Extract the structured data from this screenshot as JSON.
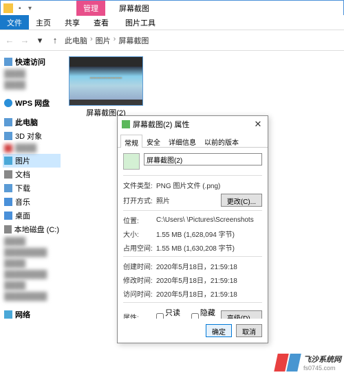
{
  "window": {
    "ribbon_context": "管理",
    "title": "屏幕截图",
    "tabs": [
      "文件",
      "主页",
      "共享",
      "查看"
    ],
    "context_tool": "图片工具"
  },
  "breadcrumb": {
    "items": [
      "此电脑",
      "图片",
      "屏幕截图"
    ]
  },
  "sidebar": {
    "quick": "快速访问",
    "wps": "WPS 网盘",
    "pc": "此电脑",
    "items": [
      {
        "icon": "cube",
        "label": "3D 对象"
      },
      {
        "icon": "vid",
        "label": "视频"
      },
      {
        "icon": "pic",
        "label": "图片"
      },
      {
        "icon": "doc",
        "label": "文档"
      },
      {
        "icon": "dl",
        "label": "下载"
      },
      {
        "icon": "mus",
        "label": "音乐"
      },
      {
        "icon": "desk",
        "label": "桌面"
      },
      {
        "icon": "disk",
        "label": "本地磁盘 (C:)"
      }
    ],
    "network": "网络"
  },
  "thumb": {
    "label": "屏幕截图(2)",
    "overlay": "····················"
  },
  "dialog": {
    "title": "屏幕截图(2) 属性",
    "tabs": [
      "常规",
      "安全",
      "详细信息",
      "以前的版本"
    ],
    "filename": "屏幕截图(2)",
    "rows": {
      "type_l": "文件类型:",
      "type_v": "PNG 图片文件 (.png)",
      "open_l": "打开方式:",
      "open_v": "照片",
      "change_btn": "更改(C)...",
      "loc_l": "位置:",
      "loc_v": "C:\\Users\\      \\Pictures\\Screenshots",
      "size_l": "大小:",
      "size_v": "1.55 MB (1,628,094 字节)",
      "disk_l": "占用空间:",
      "disk_v": "1.55 MB (1,630,208 字节)",
      "ctime_l": "创建时间:",
      "ctime_v": "2020年5月18日，21:59:18",
      "mtime_l": "修改时间:",
      "mtime_v": "2020年5月18日，21:59:18",
      "atime_l": "访问时间:",
      "atime_v": "2020年5月18日，21:59:18",
      "attr_l": "属性:",
      "readonly": "只读(R)",
      "hidden": "隐藏(H)",
      "adv_btn": "高级(D)..."
    },
    "ok": "确定",
    "cancel": "取消"
  },
  "watermark": {
    "brand": "飞沙系统网",
    "url": "fs0745.com"
  }
}
